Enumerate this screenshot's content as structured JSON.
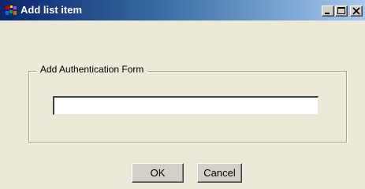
{
  "window": {
    "title": "Add list item",
    "app_icon": "app-icon",
    "controls": {
      "minimize_icon": "minimize-icon",
      "maximize_icon": "maximize-icon",
      "close_icon": "close-icon"
    }
  },
  "form": {
    "group_label": "Add Authentication Form",
    "input_value": ""
  },
  "buttons": {
    "ok_label": "OK",
    "cancel_label": "Cancel"
  },
  "colors": {
    "titlebar_start": "#0a246a",
    "titlebar_end": "#a6caf0",
    "dialog_background": "#ece9d8"
  }
}
